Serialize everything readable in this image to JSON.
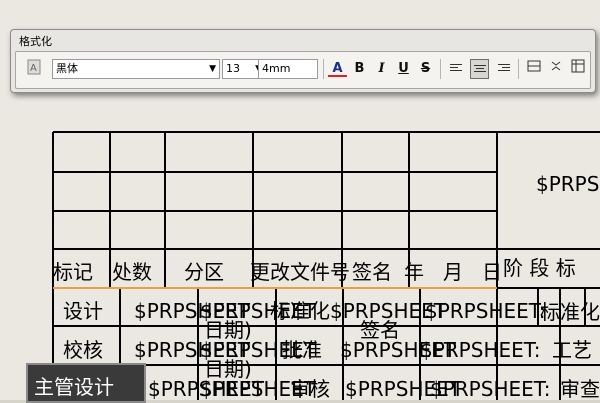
{
  "toolbar": {
    "title": "格式化",
    "font": "黑体",
    "font_size": "13",
    "line_height": "4mm",
    "buttons": {
      "bold": "B",
      "italic": "I",
      "underline": "U",
      "strike": "S"
    }
  },
  "drawing": {
    "header_row": [
      "标记",
      "处数",
      "分区",
      "更改文件号",
      "签名",
      "年",
      "月",
      "日"
    ],
    "right_header": "$PRPS",
    "stage_label": "阶 段 标",
    "rows": [
      {
        "label": "设计",
        "fill1": "$PRPSHEET",
        "fill2": "$PRPSHEET",
        "fill3": "标准化",
        "fill4": "$PRPSHEET",
        "fill5": "$PRPSHEET:"
      },
      {
        "label": "校核",
        "fill1": "$PRPSHEET",
        "fill2": "$PRPSHEET",
        "fill3": "批准",
        "fill4": "$PRPSHEET",
        "fill5": "$PRPSHEET:"
      },
      {
        "label": "主管设计",
        "fill1": "$PRPSHEET",
        "fill2": "$PRPSHEET",
        "fill3": "审核",
        "fill4": "$PRPSHEET",
        "fill5": "$PRPSHEET:"
      }
    ],
    "overlaps": {
      "a": "日期)",
      "b": "签名",
      "c": "日期)",
      "d": "标准化",
      "e": "工艺",
      "f": "审查"
    }
  },
  "colors": {
    "accent_line": "#e8a040",
    "status_bg": "#3a3a3a"
  }
}
